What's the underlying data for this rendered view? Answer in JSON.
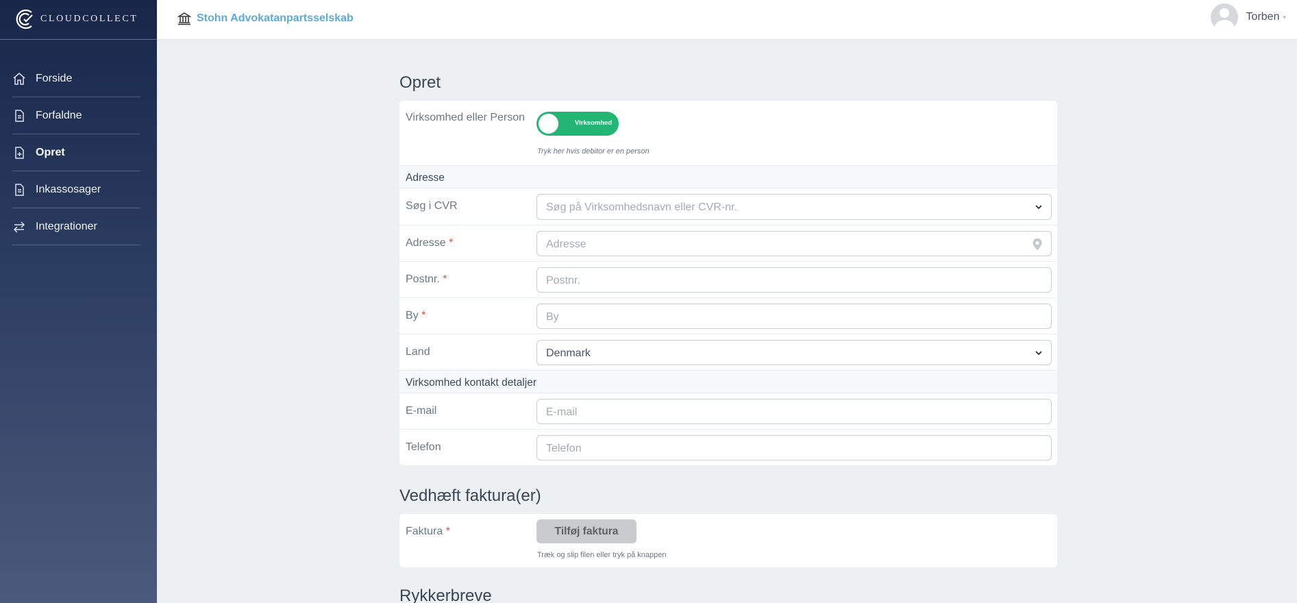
{
  "app": {
    "logo_text": "CLOUDCOLLECT"
  },
  "sidebar": {
    "items": [
      {
        "label": "Forside",
        "icon": "home-icon"
      },
      {
        "label": "Forfaldne",
        "icon": "document-icon"
      },
      {
        "label": "Opret",
        "icon": "document-plus-icon",
        "active": true
      },
      {
        "label": "Inkassosager",
        "icon": "document-icon"
      },
      {
        "label": "Integrationer",
        "icon": "swap-arrows-icon"
      }
    ]
  },
  "header": {
    "company_icon": "bank-building-icon",
    "company_name": "Stohn Advokatanpartsselskab",
    "user_name": "Torben"
  },
  "opret": {
    "title": "Opret",
    "type_label": "Virksomhed eller Person",
    "toggle_label": "Virksomhed",
    "toggle_help": "Tryk her hvis debitor er en person",
    "address_section": "Adresse",
    "cvr_label": "Søg i CVR",
    "cvr_placeholder": "Søg på Virksomhedsnavn eller CVR-nr.",
    "address_label": "Adresse",
    "address_placeholder": "Adresse",
    "postal_label": "Postnr.",
    "postal_placeholder": "Postnr.",
    "city_label": "By",
    "city_placeholder": "By",
    "country_label": "Land",
    "country_value": "Denmark",
    "contact_section": "Virksomhed kontakt detaljer",
    "email_label": "E-mail",
    "email_placeholder": "E-mail",
    "phone_label": "Telefon",
    "phone_placeholder": "Telefon",
    "required_mark": "*"
  },
  "attach": {
    "title": "Vedhæft faktura(er)",
    "invoice_label": "Faktura",
    "add_button": "Tilføj faktura",
    "help": "Træk og slip filen eller tryk på knappen"
  },
  "reminders": {
    "title": "Rykkerbreve"
  },
  "colors": {
    "sidebar_top": "#18264a",
    "accent": "#5eaad6",
    "toggle_on": "#22b573",
    "required": "#d9534f"
  }
}
